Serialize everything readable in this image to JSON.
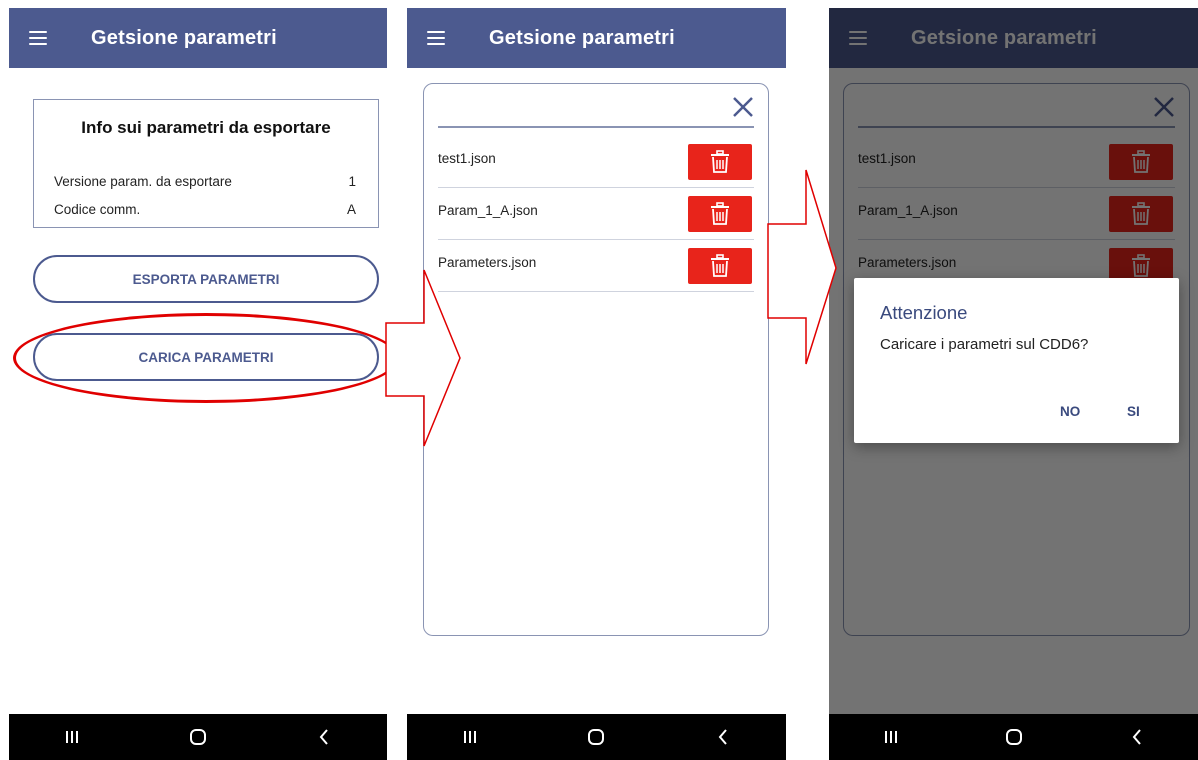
{
  "app": {
    "title": "Getsione parametri"
  },
  "screen1": {
    "info_card": {
      "title": "Info sui parametri da esportare",
      "rows": [
        {
          "label": "Versione param. da esportare",
          "value": "1"
        },
        {
          "label": "Codice comm.",
          "value": "A"
        }
      ]
    },
    "export_button": "ESPORTA PARAMETRI",
    "load_button": "CARICA PARAMETRI"
  },
  "file_dialog": {
    "files": [
      "test1.json",
      "Param_1_A.json",
      "Parameters.json"
    ]
  },
  "confirm_dialog": {
    "title": "Attenzione",
    "message": "Caricare i parametri sul CDD6?",
    "no_label": "NO",
    "yes_label": "SI"
  },
  "colors": {
    "appbar": "#4c5a8f",
    "accent_text": "#3a4a7e",
    "delete": "#e8241b",
    "highlight": "#e00000"
  },
  "icons": [
    "menu-icon",
    "close-icon",
    "trash-icon",
    "recents-icon",
    "home-icon",
    "back-icon"
  ]
}
